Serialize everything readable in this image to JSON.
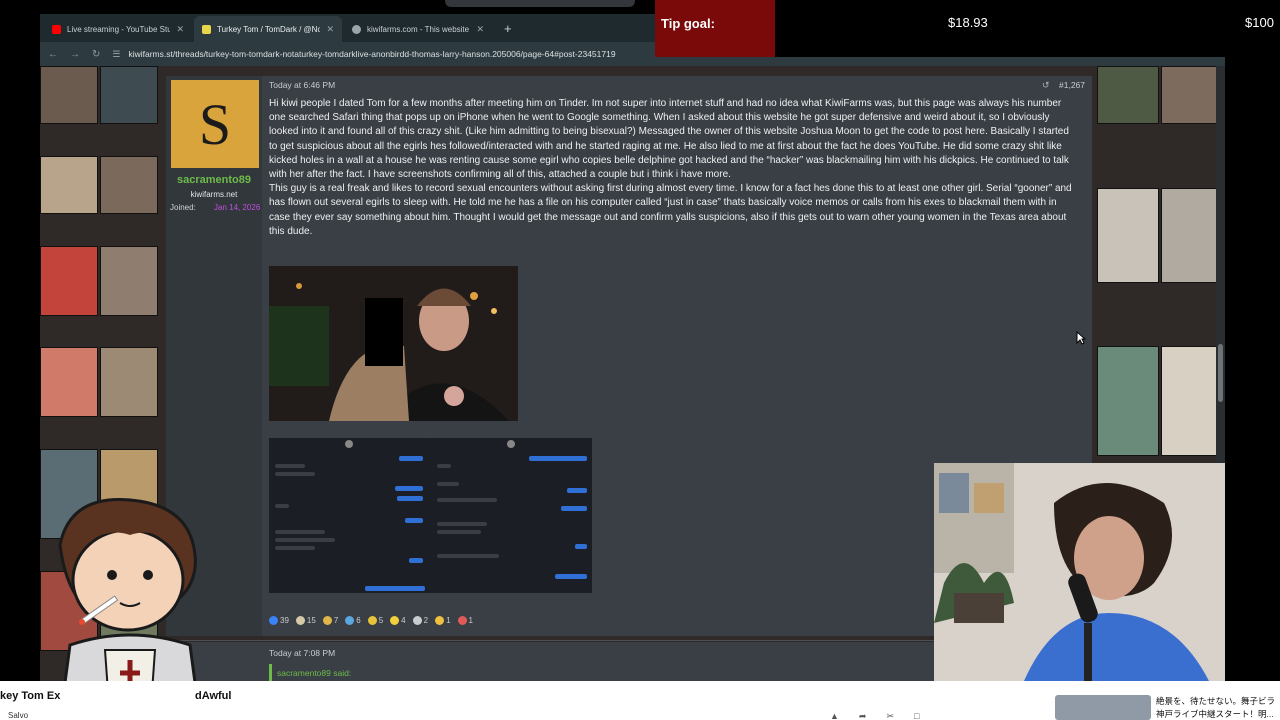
{
  "browser": {
    "tabs": [
      {
        "label": "Live streaming - YouTube Studi",
        "icon": "youtube-icon",
        "color": "#ff0000"
      },
      {
        "label": "Turkey Tom / TomDark / @Not",
        "icon": "kiwifarms-icon",
        "color": "#e8d54a"
      },
      {
        "label": "kiwifarms.com - This website is",
        "icon": "globe-icon",
        "color": "#9aa6aa"
      }
    ],
    "new_tab": "+",
    "url": "kiwifarms.st/threads/turkey-tom-tomdark-notaturkey-tomdarklive-anonbirdd-thomas-larry-hanson.205006/page-64#post-23451719"
  },
  "tip_goal": {
    "label": "Tip goal:",
    "current": "$18.93",
    "target": "$100",
    "accent": "#7a0a0a"
  },
  "post": {
    "avatar_letter": "S",
    "avatar_color": "#d9a43b",
    "username": "sacramento89",
    "user_title": "kiwifarms.net",
    "joined_label": "Joined:",
    "joined_value": "Jan 14, 2026",
    "time": "Today at 6:46 PM",
    "number": "#1,267",
    "body": [
      "Hi kiwi people I dated Tom for a few months after meeting him on Tinder. Im not super into internet stuff and had no idea what KiwiFarms was, but this page was always his number one searched Safari thing that pops up on iPhone when he went to Google something. When I asked about this website he got super defensive and weird about it, so I obviously looked into it and found all of this crazy shit. (Like him admitting to being bisexual?) Messaged the owner of this website Joshua Moon to get the code to post here. Basically I started to get suspicious about all the egirls hes followed/interacted with and he started raging at me. He also lied to me at first about the fact he does YouTube. He did some crazy shit like kicked holes in a wall at a house he was renting cause some egirl who copies belle delphine got hacked and the “hacker” was blackmailing him with his dickpics. He continued to talk with her after the fact. I have screenshots confirming all of this, attached a couple but i think i have more.",
      "This guy is a real freak and likes to record sexual encounters without asking first during almost every time. I know for a fact hes done this to at least one other girl. Serial “gooner” and has flown out several egirls to sleep with. He told me he has a file on his computer called “just in case” thats basically voice memos or calls from his exes to blackmail them with in case they ever say something about him. Thought I would get the message out and confirm yalls suspicions, also if this gets out to warn other young women in the Texas area about this dude."
    ],
    "reactions": [
      {
        "count": "39",
        "color": "#3b82f6"
      },
      {
        "count": "15",
        "color": "#d6c9a8"
      },
      {
        "count": "7",
        "color": "#e0b64a"
      },
      {
        "count": "6",
        "color": "#5aa8e0"
      },
      {
        "count": "5",
        "color": "#e8c23a"
      },
      {
        "count": "4",
        "color": "#f2d03b"
      },
      {
        "count": "2",
        "color": "#c8cdd0"
      },
      {
        "count": "1",
        "color": "#f0c040"
      },
      {
        "count": "1",
        "color": "#e05a5a"
      }
    ]
  },
  "post2": {
    "time": "Today at 7:08 PM",
    "quote_name": "sacramento89 said:"
  },
  "bottom": {
    "title_left": "key Tom Ex",
    "title_right": "dAwful",
    "channel": "Salvo",
    "rec_line1": "絶景を、待たせない。舞子ビラ",
    "rec_line2": "神戸ライブ中継スタート！明..."
  }
}
